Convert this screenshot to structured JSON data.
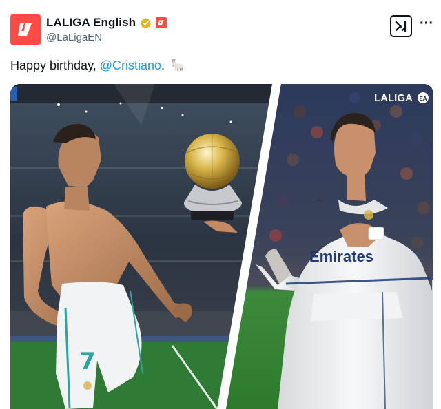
{
  "account": {
    "display_name": "LALIGA English",
    "handle": "@LaLigaEN",
    "avatar_icon": "laliga-logo-icon",
    "verified_icon": "gold-verified-badge-icon",
    "affiliate_icon": "laliga-affiliate-badge-icon"
  },
  "actions": {
    "grok_icon": "grok-icon",
    "more_label": "···"
  },
  "tweet": {
    "text_prefix": "Happy birthday, ",
    "mention": "@Cristiano",
    "text_suffix": ".",
    "emoji_icon": "goat-emoji-icon"
  },
  "media": {
    "watermark": "LALIGA",
    "left_jersey_number": "7",
    "right_sponsor": "Emirates"
  },
  "colors": {
    "brand_red": "#ff4b44",
    "mention_blue": "#1d9bf0",
    "verified_gold": "#e2b719",
    "text_primary": "#0f1419",
    "text_secondary": "#536471"
  }
}
